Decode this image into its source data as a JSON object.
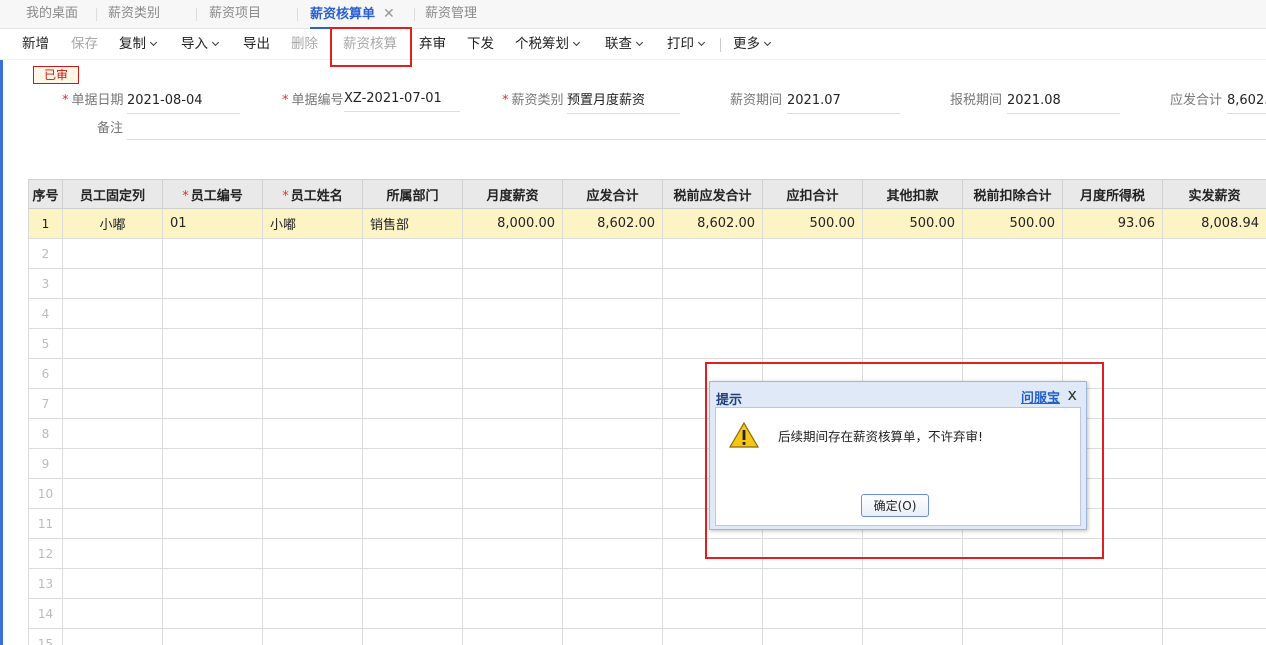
{
  "tabs": [
    {
      "label": "我的桌面"
    },
    {
      "label": "薪资类别"
    },
    {
      "label": "薪资项目"
    },
    {
      "label": "薪资核算单",
      "close": "✕"
    },
    {
      "label": "薪资管理"
    }
  ],
  "toolbar": {
    "add": "新增",
    "save": "保存",
    "copy": "复制",
    "import": "导入",
    "export": "导出",
    "delete": "删除",
    "calc": "薪资核算",
    "unaudit": "弃审",
    "issue": "下发",
    "tax_plan": "个税筹划",
    "query": "联查",
    "print": "打印",
    "more": "更多"
  },
  "form": {
    "status": "已审",
    "date_label": "单据日期",
    "date_value": "2021-08-04",
    "no_label": "单据编号",
    "no_value": "XZ-2021-07-01",
    "category_label": "薪资类别",
    "category_value": "预置月度薪资",
    "period_label": "薪资期间",
    "period_value": "2021.07",
    "tax_period_label": "报税期间",
    "tax_period_value": "2021.08",
    "total_label": "应发合计",
    "total_value": "8,602.",
    "remark_label": "备注"
  },
  "grid": {
    "columns": [
      "序号",
      "员工固定列",
      "员工编号",
      "员工姓名",
      "所属部门",
      "月度薪资",
      "应发合计",
      "税前应发合计",
      "应扣合计",
      "其他扣款",
      "税前扣除合计",
      "月度所得税",
      "实发薪资"
    ],
    "row1": {
      "seq": "1",
      "fixed": "小嘟",
      "code": "01",
      "name": "小嘟",
      "dept": "销售部",
      "monthly": "8,000.00",
      "gross": "8,602.00",
      "pretax_gross": "8,602.00",
      "deduct": "500.00",
      "other_deduct": "500.00",
      "pretax_deduct": "500.00",
      "income_tax": "93.06",
      "net": "8,008.94"
    },
    "empty_rows": [
      "2",
      "3",
      "4",
      "5",
      "6",
      "7",
      "8",
      "9",
      "10",
      "11",
      "12",
      "13",
      "14",
      "15"
    ]
  },
  "dialog": {
    "title": "提示",
    "help": "问服宝",
    "close": "x",
    "message": "后续期间存在薪资核算单，不许弃审!",
    "ok": "确定(O)"
  }
}
